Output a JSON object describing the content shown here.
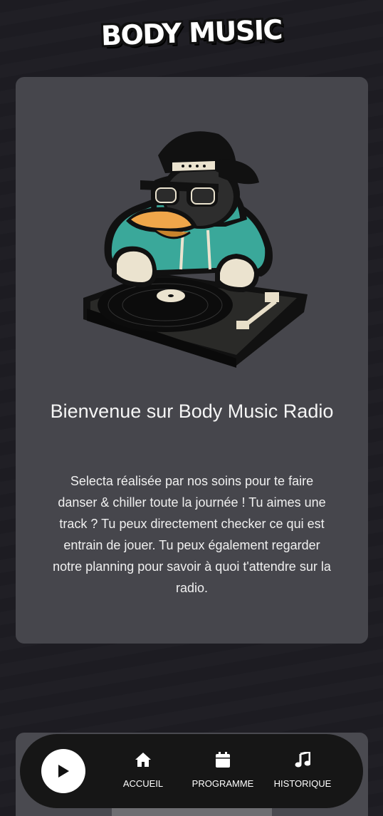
{
  "brand": {
    "logo_text": "BODY MUSIC"
  },
  "welcome": {
    "title": "Bienvenue sur Body Music Radio",
    "text": "Selecta réalisée par nos soins pour te faire danser & chiller toute la journée ! Tu aimes une track ? Tu peux directement checker ce qui est entrain de jouer. Tu peux également regarder notre planning pour savoir à quoi t'attendre sur la radio."
  },
  "player": {
    "play_icon": "play-icon",
    "nav": [
      {
        "label": "ACCUEIL",
        "icon": "home-icon"
      },
      {
        "label": "PROGRAMME",
        "icon": "calendar-icon"
      },
      {
        "label": "HISTORIQUE",
        "icon": "music-note-icon"
      }
    ]
  },
  "colors": {
    "background": "#1c1b21",
    "card": "#46464c",
    "player_bar": "#161616",
    "hoodie": "#3aa89a",
    "beak": "#f0a64a"
  }
}
